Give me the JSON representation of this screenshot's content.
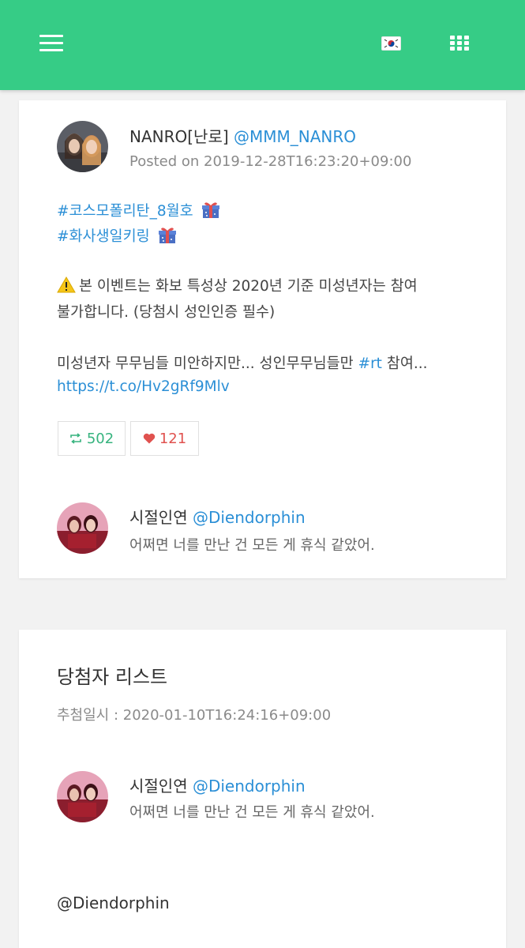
{
  "header": {
    "menu_icon": "hamburger-menu-icon",
    "language_icon": "korea-flag-icon",
    "apps_icon": "grid-apps-icon",
    "accent_color": "#36cc86"
  },
  "post": {
    "author_name": "NANRO[난로]",
    "author_handle": "@MMM_NANRO",
    "posted": "Posted on 2019-12-28T16:23:20+09:00",
    "hashtag1": "#코스모폴리탄_8월호",
    "hashtag2": "#화사생일키링",
    "notice_line1": "본 이벤트는 화보 특성상 2020년 기준 미성년자는 참여",
    "notice_line2": "불가합니다. (당첨시 성인인증 필수)",
    "body_prefix": "미성년자 무무님들 미안하지만... 성인무무님들만 ",
    "body_tag": "#rt",
    "body_suffix": " 참여...",
    "link": "https://t.co/Hv2gRf9Mlv",
    "retweet_count": "502",
    "like_count": "121",
    "reply_author": "시절인연",
    "reply_handle": "@Diendorphin",
    "reply_text": "어쩌면 너를 만난 건 모든 게 휴식 같았어."
  },
  "winners": {
    "title": "당첨자 리스트",
    "draw_date": "추첨일시 : 2020-01-10T16:24:16+09:00",
    "winner_name": "시절인연",
    "winner_handle": "@Diendorphin",
    "winner_bio": "어쩌면 너를 만난 건 모든 게 휴식 같았어.",
    "winner_mention": "@Diendorphin"
  }
}
